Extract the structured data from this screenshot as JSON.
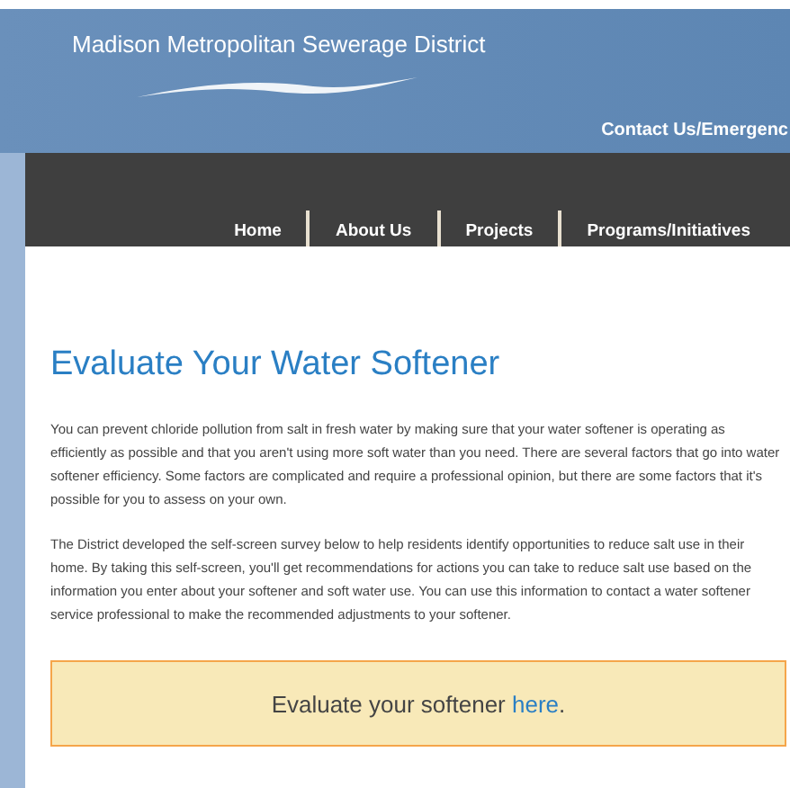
{
  "header": {
    "site_name": "Madison Metropolitan Sewerage District",
    "utility_link": "Contact Us/Emergenc"
  },
  "nav": [
    {
      "label": "Home"
    },
    {
      "label": "About Us"
    },
    {
      "label": "Projects"
    },
    {
      "label": "Programs/Initiatives"
    }
  ],
  "page": {
    "title": "Evaluate Your Water Softener",
    "paragraphs": [
      "You can prevent chloride pollution from salt in fresh water by making sure that your water softener is operating as efficiently as possible and that you aren't using more soft water than you need. There are several factors that go into water softener efficiency. Some factors are complicated and require a professional opinion, but there are some factors that it's possible for you to assess on your own.",
      "The District developed the self-screen survey below to help residents identify opportunities to reduce salt use in their home. By taking this self-screen, you'll get recommendations for actions you can take to reduce salt use based on the information you enter about your softener and soft water use. You can use this information to contact a water softener service professional to make the recommended adjustments to your softener."
    ],
    "callout": {
      "text": "Evaluate your softener",
      "link": "here",
      "after": "."
    }
  }
}
